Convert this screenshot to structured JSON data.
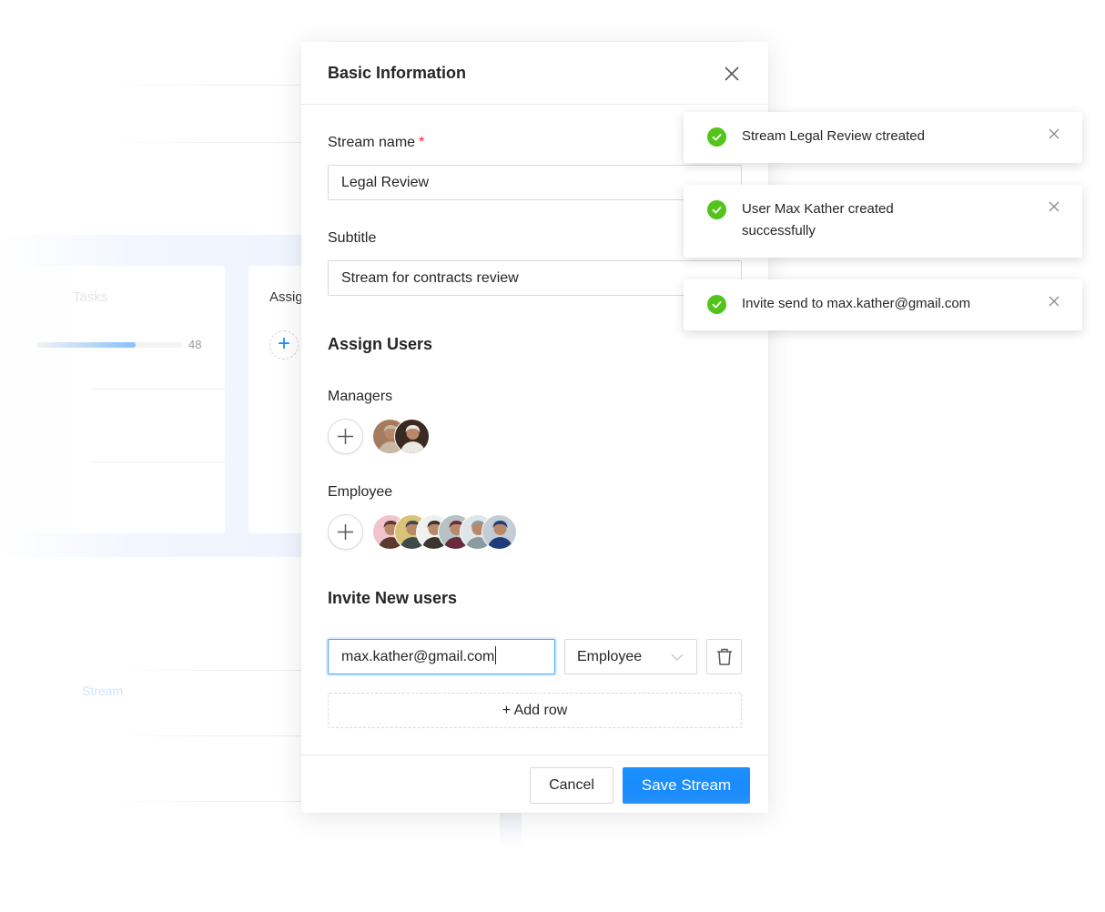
{
  "background": {
    "tasks_card": {
      "title": "Tasks",
      "progress_percent": 68,
      "progress_value": "48"
    },
    "assign_card": {
      "title": "Assign",
      "add_icon": "plus-icon"
    },
    "stream_link": "Stream"
  },
  "modal": {
    "title": "Basic Information",
    "close_icon": "close-icon",
    "stream_name": {
      "label": "Stream name",
      "required_mark": "*",
      "value": "Legal Review"
    },
    "subtitle": {
      "label": "Subtitle",
      "value": "Stream for contracts review"
    },
    "assign_users": {
      "title": "Assign Users",
      "managers": {
        "label": "Managers",
        "avatars": [
          {
            "name": "manager-avatar-1",
            "colors": [
              "#a57b5e",
              "#c9b8a3"
            ]
          },
          {
            "name": "manager-avatar-2",
            "colors": [
              "#3b2a22",
              "#ece7e1"
            ]
          }
        ]
      },
      "employees": {
        "label": "Employee",
        "avatars": [
          {
            "name": "employee-avatar-1",
            "colors": [
              "#f1c4cc",
              "#5a3a2e"
            ]
          },
          {
            "name": "employee-avatar-2",
            "colors": [
              "#d9c27a",
              "#3d4b4a"
            ]
          },
          {
            "name": "employee-avatar-3",
            "colors": [
              "#f0f0f0",
              "#3b3530"
            ]
          },
          {
            "name": "employee-avatar-4",
            "colors": [
              "#b7c2c5",
              "#6a2a3d"
            ]
          },
          {
            "name": "employee-avatar-5",
            "colors": [
              "#dfe6ea",
              "#8a9a9e"
            ]
          },
          {
            "name": "employee-avatar-6",
            "colors": [
              "#c4ccd6",
              "#1f3d7a"
            ]
          }
        ]
      }
    },
    "invite": {
      "title": "Invite New users",
      "rows": [
        {
          "email": "max.kather@gmail.com",
          "role": "Employee"
        }
      ],
      "add_row_label": "+ Add row"
    },
    "footer": {
      "cancel_label": "Cancel",
      "save_label": "Save Stream"
    }
  },
  "notifications": [
    {
      "type": "success",
      "message": "Stream Legal Review ctreated"
    },
    {
      "type": "success",
      "message": "User Max Kather created successfully"
    },
    {
      "type": "success",
      "message": "Invite send to max.kather@gmail.com"
    }
  ],
  "colors": {
    "primary": "#1a8cff",
    "success": "#52c41a",
    "required": "#f5222d",
    "focus_border": "#40a9ff"
  }
}
